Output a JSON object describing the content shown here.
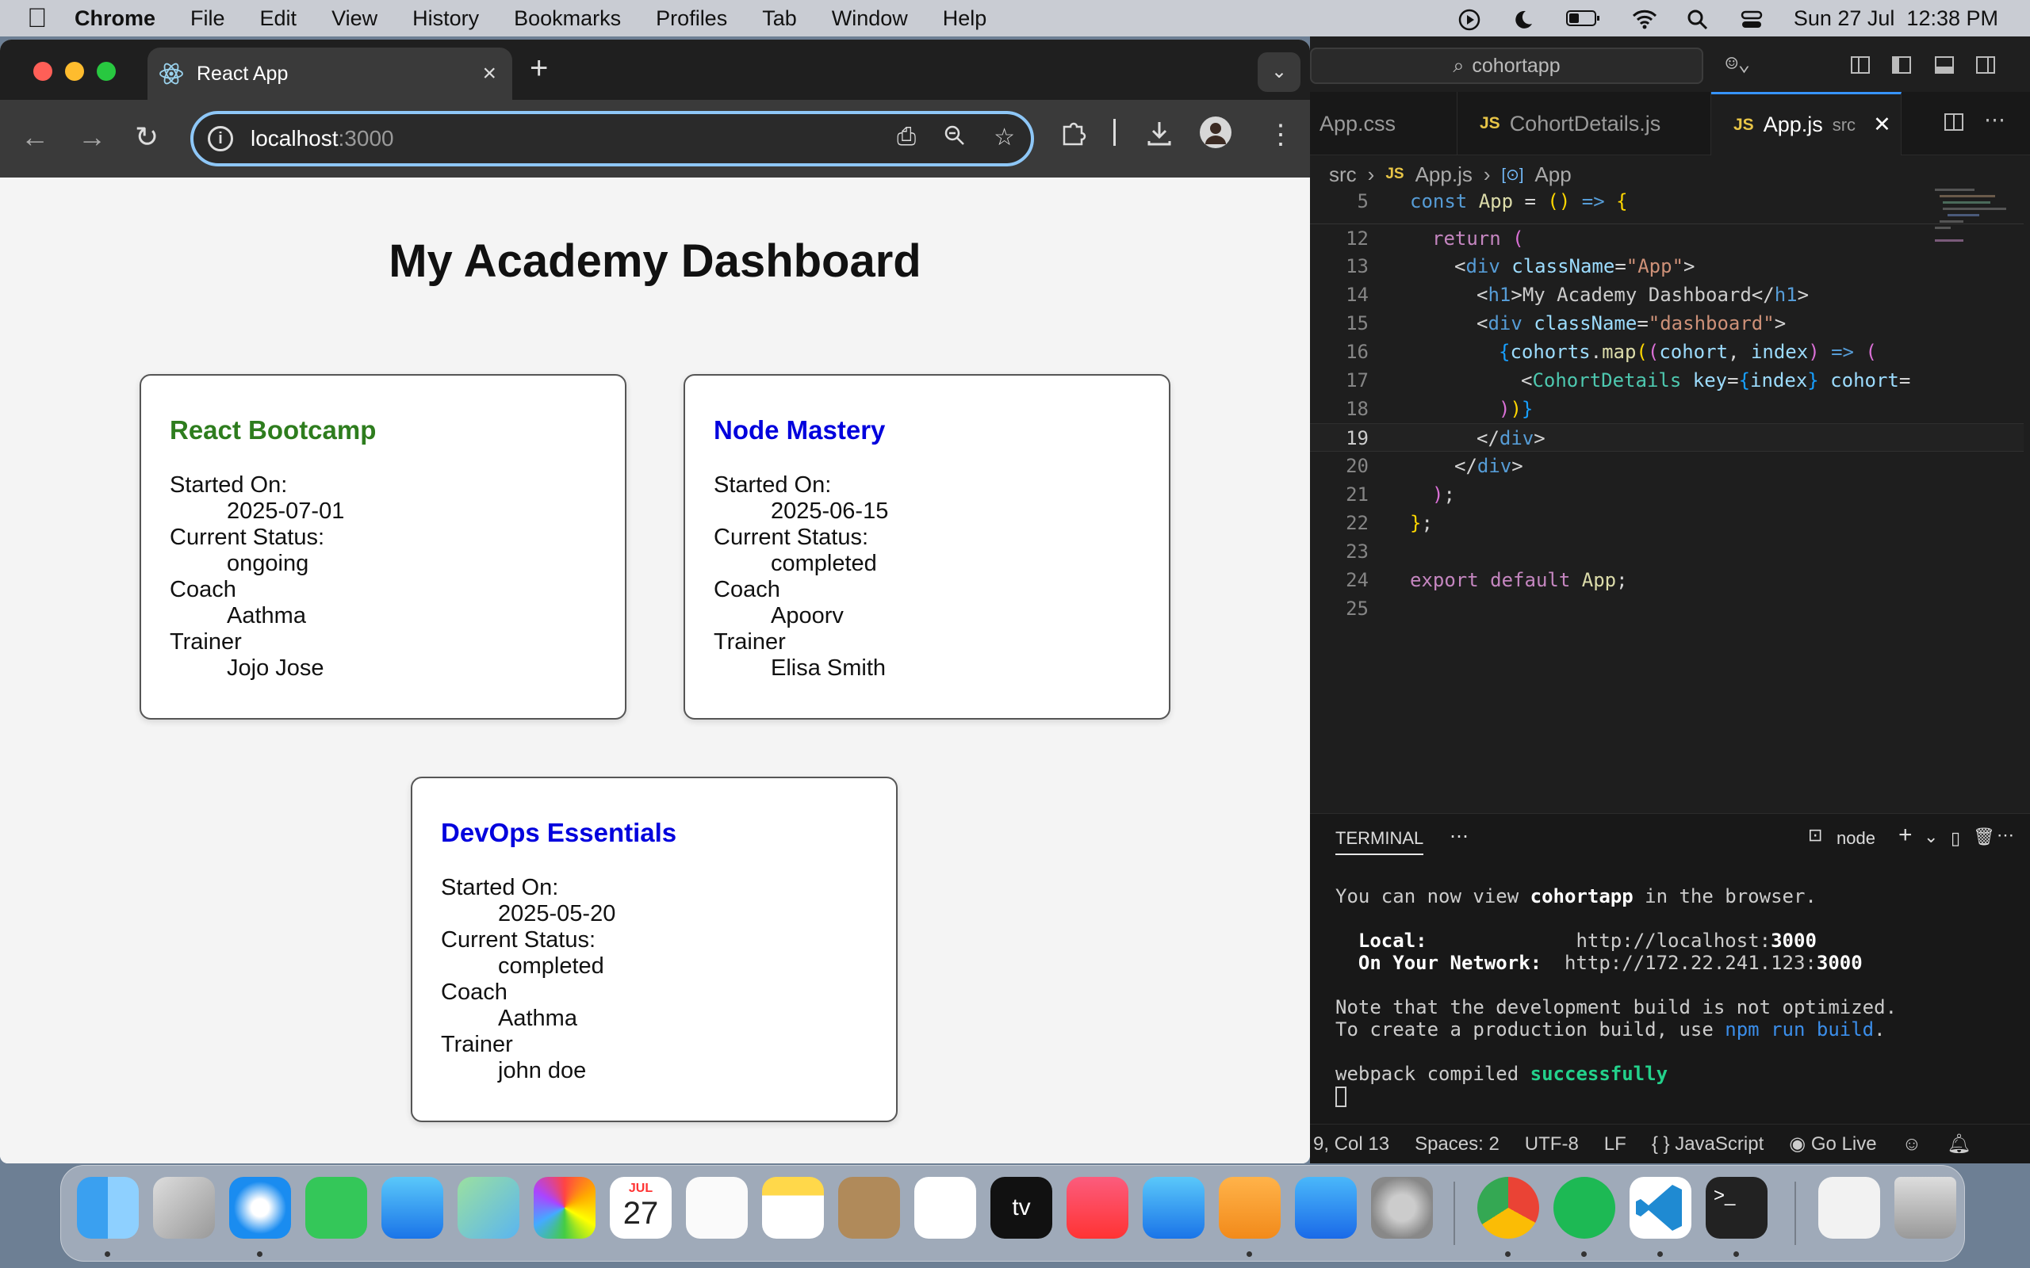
{
  "menubar": {
    "app_name": "Chrome",
    "items": [
      "File",
      "Edit",
      "View",
      "History",
      "Bookmarks",
      "Profiles",
      "Tab",
      "Window",
      "Help"
    ],
    "clock": "Sun 27 Jul  12:38 PM"
  },
  "browser": {
    "tab_title": "React App",
    "url_host": "localhost",
    "url_port": ":3000"
  },
  "page": {
    "title": "My Academy Dashboard",
    "labels": {
      "started": "Started On:",
      "status": "Current Status:",
      "coach": "Coach",
      "trainer": "Trainer"
    },
    "cohorts": [
      {
        "name": "React Bootcamp",
        "started": "2025-07-01",
        "status": "ongoing",
        "coach": "Aathma",
        "trainer": "Jojo Jose",
        "title_color": "#2e7d1e"
      },
      {
        "name": "Node Mastery",
        "started": "2025-06-15",
        "status": "completed",
        "coach": "Apoorv",
        "trainer": "Elisa Smith",
        "title_color": "#0000dd"
      },
      {
        "name": "DevOps Essentials",
        "started": "2025-05-20",
        "status": "completed",
        "coach": "Aathma",
        "trainer": "john doe",
        "title_color": "#0000dd"
      }
    ]
  },
  "vscode": {
    "search": "cohortapp",
    "tabs": [
      "App.css",
      "CohortDetails.js",
      "App.js"
    ],
    "active_tab_suffix": "src",
    "breadcrumb": [
      "src",
      "App.js",
      "App"
    ],
    "line_numbers": [
      "5",
      "12",
      "13",
      "14",
      "15",
      "16",
      "17",
      "18",
      "19",
      "20",
      "21",
      "22",
      "23",
      "24",
      "25"
    ],
    "panel_title": "TERMINAL",
    "terminal_shell": "node",
    "terminal": {
      "line1_a": "You can now view ",
      "line1_b": "cohortapp",
      "line1_c": " in the browser.",
      "local_label": "Local:",
      "local_url_a": "http://localhost:",
      "local_url_b": "3000",
      "network_label": "On Your Network:",
      "network_url_a": "http://172.22.241.123:",
      "network_url_b": "3000",
      "note1": "Note that the development build is not optimized.",
      "note2_a": "To create a production build, use ",
      "note2_b": "npm run build",
      "note2_c": ".",
      "compiled_a": "webpack compiled ",
      "compiled_b": "successfully"
    },
    "status": {
      "position": "9, Col 13",
      "spaces": "Spaces: 2",
      "encoding": "UTF-8",
      "eol": "LF",
      "language": "JavaScript",
      "go_live": "Go Live"
    }
  },
  "dock": {
    "calendar_month": "JUL",
    "calendar_day": "27"
  }
}
